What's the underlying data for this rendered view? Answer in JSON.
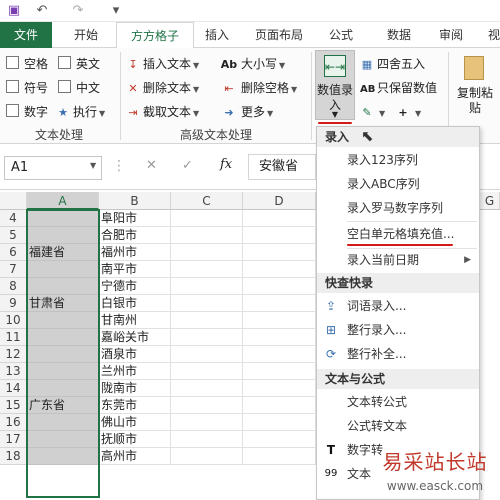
{
  "qab": {
    "icons": [
      "save-icon",
      "undo-icon",
      "redo-icon",
      "customize-icon"
    ],
    "glyphs": [
      "▣",
      "↶",
      "↷",
      "▾"
    ]
  },
  "tabs": [
    {
      "label": "文件"
    },
    {
      "label": "开始"
    },
    {
      "label": "方方格子"
    },
    {
      "label": "插入"
    },
    {
      "label": "页面布局"
    },
    {
      "label": "公式"
    },
    {
      "label": "数据"
    },
    {
      "label": "审阅"
    },
    {
      "label": "视"
    }
  ],
  "ribbon": {
    "text_processing": {
      "checkboxes": [
        {
          "label": "空格"
        },
        {
          "label": "英文"
        },
        {
          "label": "符号"
        },
        {
          "label": "中文"
        },
        {
          "label": "数字"
        }
      ],
      "execute_label": "执行",
      "group_label": "文本处理"
    },
    "advanced_text": {
      "insert_text": "插入文本",
      "delete_text": "删除文本",
      "cut_text": "截取文本",
      "case": "大小写",
      "delete_space": "删除空格",
      "more": "更多",
      "ab_glyph": "Ab",
      "group_label": "高级文本处理"
    },
    "number_entry": {
      "line1": "数值录",
      "line2": "入"
    },
    "round": "四舍五入",
    "keep_value": "只保留数值",
    "paste": {
      "line1": "复制粘",
      "line2": "贴"
    }
  },
  "formula_bar": {
    "name_box": "A1",
    "fx": "fx",
    "value": "安徽省"
  },
  "grid": {
    "columns": [
      "A",
      "B",
      "C",
      "D"
    ],
    "rows": [
      {
        "num": "4",
        "a": "",
        "b": "阜阳市"
      },
      {
        "num": "5",
        "a": "",
        "b": "合肥市"
      },
      {
        "num": "6",
        "a": "福建省",
        "b": "福州市"
      },
      {
        "num": "7",
        "a": "",
        "b": "南平市"
      },
      {
        "num": "8",
        "a": "",
        "b": "宁德市"
      },
      {
        "num": "9",
        "a": "甘肃省",
        "b": "白银市"
      },
      {
        "num": "10",
        "a": "",
        "b": "甘南州"
      },
      {
        "num": "11",
        "a": "",
        "b": "嘉峪关市"
      },
      {
        "num": "12",
        "a": "",
        "b": "酒泉市"
      },
      {
        "num": "13",
        "a": "",
        "b": "兰州市"
      },
      {
        "num": "14",
        "a": "",
        "b": "陇南市"
      },
      {
        "num": "15",
        "a": "广东省",
        "b": "东莞市"
      },
      {
        "num": "16",
        "a": "",
        "b": "佛山市"
      },
      {
        "num": "17",
        "a": "",
        "b": "抚顺市"
      },
      {
        "num": "18",
        "a": "",
        "b": "高州市"
      }
    ],
    "extra_col": "G"
  },
  "menu": {
    "section_entry": "录入",
    "item_123": "录入123序列",
    "item_abc": "录入ABC序列",
    "item_roman": "录入罗马数字序列",
    "item_fill_blank": "空白单元格填充值...",
    "item_date": "录入当前日期",
    "section_quick": "快查快录",
    "item_word": "词语录入...",
    "item_row_entry": "整行录入...",
    "item_row_fill": "整行补全...",
    "section_text_formula": "文本与公式",
    "item_text_to_formula": "文本转公式",
    "item_formula_to_text": "公式转文本",
    "item_number_partial": "数字转",
    "item_text_partial": "文本",
    "icon_T": "T",
    "icon_99": "99"
  },
  "watermark": {
    "text": "易采站长站",
    "url": "www.easck.com"
  },
  "colors": {
    "excel_green": "#217346",
    "red_mark": "#d21a1a",
    "selected_col": "#d0d0d0"
  }
}
